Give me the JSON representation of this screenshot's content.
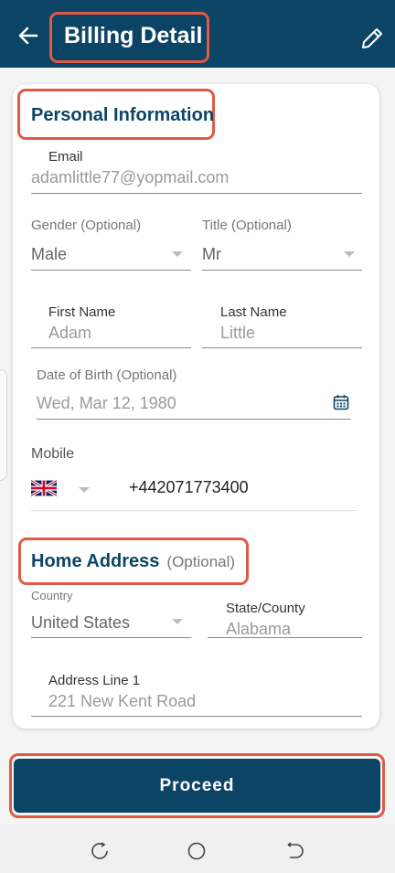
{
  "header": {
    "title": "Billing Detail",
    "back_icon": "arrow-left-icon",
    "edit_icon": "pencil-icon"
  },
  "personal": {
    "section_title": "Personal Information",
    "email": {
      "label": "Email",
      "value": "adamlittle77@yopmail.com"
    },
    "gender": {
      "label": "Gender (Optional)",
      "value": "Male"
    },
    "title": {
      "label": "Title (Optional)",
      "value": "Mr"
    },
    "first_name": {
      "label": "First Name",
      "value": "Adam"
    },
    "last_name": {
      "label": "Last Name",
      "value": "Little"
    },
    "dob": {
      "label": "Date of Birth  (Optional)",
      "value": "Wed, Mar 12, 1980",
      "icon": "calendar-icon"
    },
    "mobile": {
      "label": "Mobile",
      "value": "+442071773400",
      "flag_icon": "uk-flag-icon"
    }
  },
  "address": {
    "section_title": "Home Address",
    "optional": "(Optional)",
    "country": {
      "label": "Country",
      "value": "United States"
    },
    "state": {
      "label": "State/County",
      "value": "Alabama"
    },
    "line1": {
      "label": "Address Line 1",
      "value": "221 New Kent Road"
    }
  },
  "actions": {
    "proceed_label": "Proceed"
  },
  "nav": {
    "recent_icon": "recent-apps-icon",
    "home_icon": "home-icon",
    "back_icon": "nav-back-icon"
  },
  "colors": {
    "primary": "#0c4466",
    "highlight": "#e05a45"
  }
}
